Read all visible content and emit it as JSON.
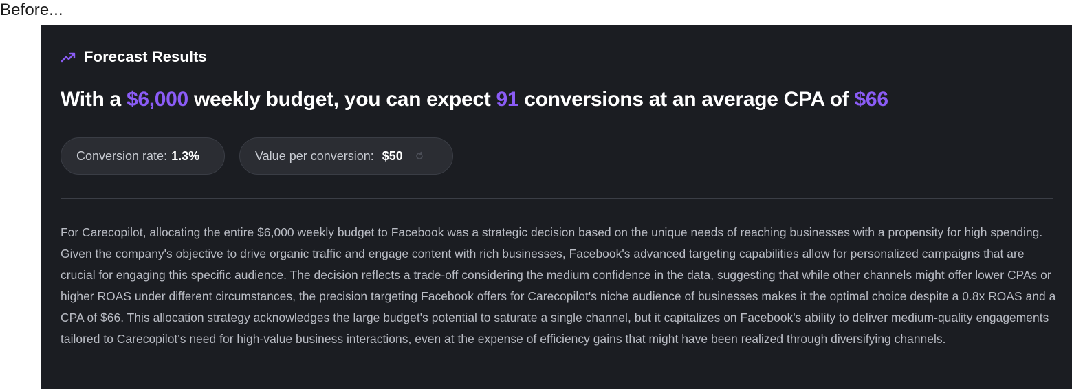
{
  "caption": "Before...",
  "forecast": {
    "title": "Forecast Results",
    "icon": "trending-up-icon",
    "accent_color": "#8b5cf6",
    "headline": {
      "part1": "With a ",
      "budget": "$6,000",
      "part2": " weekly budget, you can expect ",
      "conversions": "91",
      "part3": " conversions at an average CPA of ",
      "cpa": "$66"
    },
    "metrics": {
      "conversion_rate_label": "Conversion rate:",
      "conversion_rate_value": "1.3%",
      "value_per_conversion_label": "Value per conversion:",
      "value_per_conversion_value": "$50",
      "refresh_icon": "refresh-icon"
    },
    "explanation": "For Carecopilot, allocating the entire $6,000 weekly budget to Facebook was a strategic decision based on the unique needs of reaching businesses with a propensity for high spending. Given the company's objective to drive organic traffic and engage content with rich businesses, Facebook's advanced targeting capabilities allow for personalized campaigns that are crucial for engaging this specific audience. The decision reflects a trade-off considering the medium confidence in the data, suggesting that while other channels might offer lower CPAs or higher ROAS under different circumstances, the precision targeting Facebook offers for Carecopilot's niche audience of businesses makes it the optimal choice despite a 0.8x ROAS and a CPA of $66. This allocation strategy acknowledges the large budget's potential to saturate a single channel, but it capitalizes on Facebook's ability to deliver medium-quality engagements tailored to Carecopilot's need for high-value business interactions, even at the expense of efficiency gains that might have been realized through diversifying channels."
  }
}
